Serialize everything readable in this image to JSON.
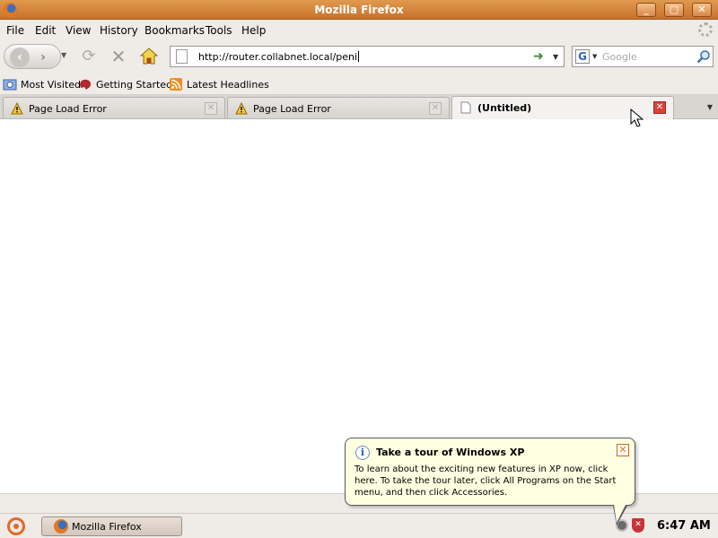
{
  "window": {
    "title": "Mozilla Firefox",
    "minimize_label": "_",
    "maximize_label": "□",
    "close_label": "✕"
  },
  "menu": {
    "items": [
      "File",
      "Edit",
      "View",
      "History",
      "Bookmarks",
      "Tools",
      "Help"
    ]
  },
  "nav": {
    "back_glyph": "‹",
    "forward_glyph": "›",
    "dropdown_glyph": "▼",
    "reload_glyph": "⟳",
    "stop_glyph": "✕",
    "url": "http://router.collabnet.local/peni",
    "go_glyph": "➜",
    "search_engine_glyph": "G",
    "search_placeholder": "Google"
  },
  "bookmarks": {
    "items": [
      {
        "label": "Most Visited",
        "icon": "most-visited-folder-icon"
      },
      {
        "label": "Getting Started",
        "icon": "getting-started-icon"
      },
      {
        "label": "Latest Headlines",
        "icon": "rss-feed-icon"
      }
    ]
  },
  "tabs": {
    "items": [
      {
        "label": "Page Load Error",
        "active": false,
        "icon": "warning-icon"
      },
      {
        "label": "Page Load Error",
        "active": false,
        "icon": "warning-icon"
      },
      {
        "label": "(Untitled)",
        "active": true,
        "icon": "blank-page-icon"
      }
    ],
    "close_glyph": "✕",
    "all_tabs_glyph": "▼"
  },
  "balloon": {
    "title": "Take a tour of Windows XP",
    "body": "To learn about the exciting new features in XP now, click here. To take the tour later, click All Programs on the Start menu, and then click Accessories.",
    "info_glyph": "i",
    "close_glyph": "✕"
  },
  "taskbar": {
    "task_label": "Mozilla Firefox",
    "clock": "6:47 AM",
    "shield_glyph": "✕"
  },
  "colors": {
    "titlebar": "#d7823a",
    "chrome": "#efebe7",
    "balloon": "#ffffe1",
    "active_tab_close": "#d9433a"
  }
}
